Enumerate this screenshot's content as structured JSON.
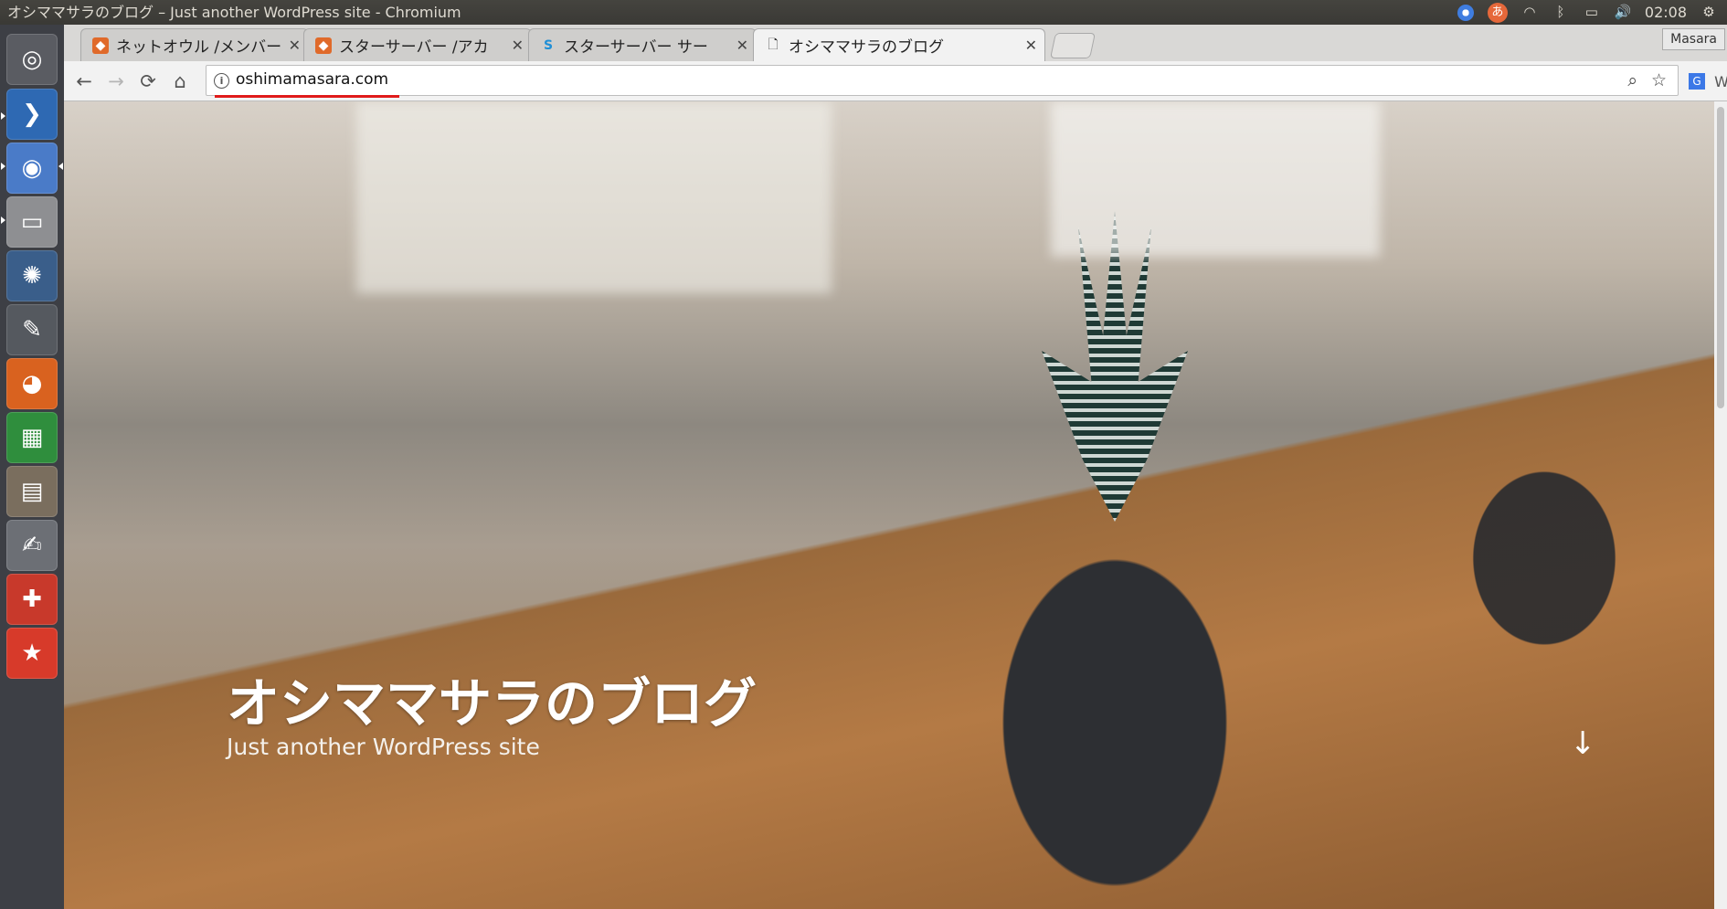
{
  "system": {
    "window_title": "オシママサラのブログ – Just another WordPress site - Chromium",
    "ime_label": "あ",
    "clock": "02:08",
    "user": "Masara"
  },
  "launcher": {
    "items": [
      "ubuntu-dash",
      "vscode",
      "chromium",
      "files-drive",
      "shotwell",
      "libreoffice-draw",
      "firefox",
      "libreoffice-calc",
      "archive-manager",
      "text-editor",
      "system-tool",
      "bookmark-app"
    ]
  },
  "tabs": [
    {
      "label": "ネットオウル /メンバー",
      "favicon": "owl-icon"
    },
    {
      "label": "スターサーバー /アカ",
      "favicon": "owl-icon"
    },
    {
      "label": "スターサーバー サー",
      "favicon": "star-server-icon"
    },
    {
      "label": "オシママサラのブログ",
      "favicon": "page-icon",
      "active": true
    }
  ],
  "toolbar": {
    "url": "oshimamasara.com",
    "back_icon": "←",
    "forward_icon": "→",
    "reload_icon": "⟳",
    "home_icon": "⌂",
    "ext_w": "W"
  },
  "page": {
    "title": "オシママサラのブログ",
    "tagline": "Just another WordPress site",
    "scroll_arrow": "↓"
  }
}
